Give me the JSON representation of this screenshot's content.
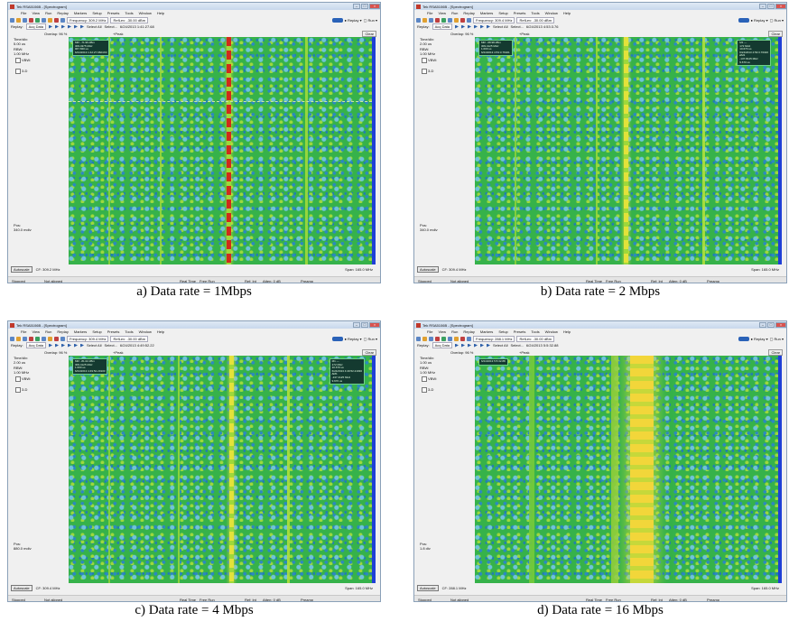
{
  "panels": [
    {
      "caption": "a) Data rate = 1Mbps",
      "title": "Tek RSA5106B - [Spectrogram]",
      "frequency": "Frequency: 309.2 MHz",
      "ref_lev": "RefLev: -30.00 dBm",
      "time_display": "6/24/2013 1:41:27.68",
      "overlap": "Overlap: 96 %",
      "time_div": "Time/div:\n5.00 us",
      "rbw": "RBW:\n1.00 MHz",
      "pos": "Pos:\n340.0 mdiv",
      "cf": "CF: 309.2 MHz",
      "span": "Span: 165.0 MHz",
      "marker": "MR: -71.96 dBm\n309.4375 MHz\n967.840 us\n6/24/2013 1:42:27.6824X0"
    },
    {
      "caption": "b) Data rate = 2 Mbps",
      "title": "Tek RSA5106B - [Spectrogram]",
      "frequency": "Frequency: 309.4 MHz",
      "ref_lev": "RefLev: -30.00 dBm",
      "time_display": "6/24/2013 4:53:3.76",
      "overlap": "Overlap: 96 %",
      "time_div": "Time/div:\n2.00 us",
      "rbw": "RBW:\n1.00 MHz",
      "pos": "Pos:\n340.0 mdiv",
      "cf": "CF: 309.4 MHz",
      "span": "Span: 165.0 MHz",
      "marker": "MR: -68.98 dBm\n309.4125 MHz\n1.000 us\n6/24/2013 4:53:3.76321",
      "marker_right": "M1 ---\n172 MHz\n10.670 us\n6/24/2013 4:53:3.76320\n∆M1\n-137.8125 MHz\n9.670 us"
    },
    {
      "caption": "c) Data rate = 4 Mbps",
      "title": "Tek RSA5106B - [Spectrogram]",
      "frequency": "Frequency: 309.4 MHz",
      "ref_lev": "RefLev: -30.00 dBm",
      "time_display": "6/24/2013 4:49:52.22",
      "overlap": "Overlap: 96 %",
      "time_div": "Time/div:\n2.00 us",
      "rbw": "RBW:\n1.00 MHz",
      "pos": "Pos:\n880.0 mdiv",
      "cf": "CF: 309.4 MHz",
      "span": "Span: 165.0 MHz",
      "marker": "MR: -81.02 dBm\n309.4125 MHz\n1.000 us\n6/24/2013 4:49:52.21930",
      "marker_right": "M1 ---\n172 MHz\n10.670 us\n6/24/2013 4:49:52.21930\n∆M1\n-137.4125 MHz\n9.670 us"
    },
    {
      "caption": "d) Data rate = 16 Mbps",
      "title": "Tek RSA5106B - [Spectrogram]",
      "frequency": "Frequency: 288.1 MHz",
      "ref_lev": "RefLev: -30.00 dBm",
      "time_display": "6/24/2013 5:5:32.88",
      "overlap": "Overlap: 96 %",
      "time_div": "Time/div:\n1.00 us",
      "rbw": "RBW:\n1.00 MHz",
      "pos": "Pos:\n1.8 div",
      "cf": "CF: 288.1 MHz",
      "span": "Span: 165.0 MHz",
      "marker": "6/24/2013 5:5:32.88"
    }
  ],
  "menu": [
    "File",
    "View",
    "Run",
    "Replay",
    "Markers",
    "Setup",
    "Presets",
    "Tools",
    "Window",
    "Help"
  ],
  "toolbar": {
    "replay_label": "Replay:",
    "replay_mode": "Acq Data",
    "select_all": "Select All",
    "select": "Select...",
    "replay_button": "● Replay ▾",
    "run_button": "▢ Run ▾"
  },
  "display": {
    "peak_label": "+Peak",
    "clear_label": "Clear",
    "vbw_label": "VBW:",
    "threed_label": "3-D",
    "autoscale_label": "Autoscale"
  },
  "status": {
    "stopped": "Stopped",
    "aligned": "Not aligned",
    "realtime": "Real Time",
    "freerun": "Free Run",
    "ref": "Ref: Int",
    "atten": "Atten: 0 dB",
    "preamp": "Preamp"
  },
  "colors": {
    "background": "#36b24a",
    "noise_low": "#2a7fe0",
    "signal_mid": "#d9e23a",
    "signal_peak": "#d02a1a",
    "edge": "#1f3fd6"
  }
}
